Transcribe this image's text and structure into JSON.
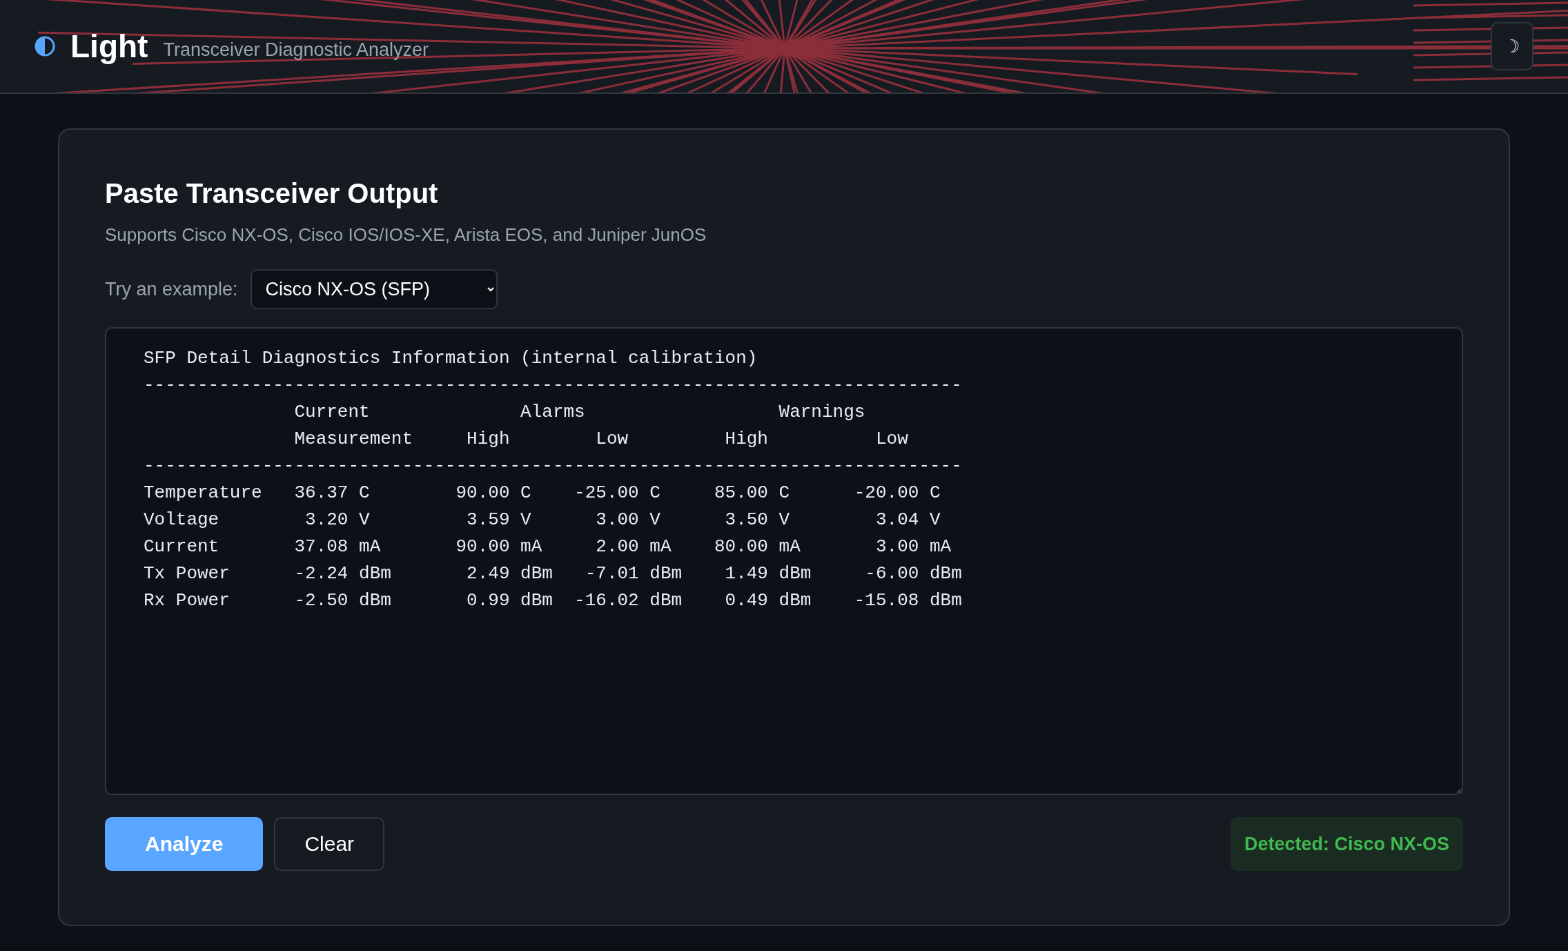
{
  "header": {
    "title": "Light",
    "subtitle": "Transceiver Diagnostic Analyzer",
    "theme_toggle": "☽"
  },
  "panel": {
    "title": "Paste Transceiver Output",
    "description": "Supports Cisco NX-OS, Cisco IOS/IOS-XE, Arista EOS, and Juniper JunOS",
    "example_label": "Try an example:",
    "example_select": {
      "value": "Cisco NX-OS (SFP)"
    },
    "output_text": "SFP Detail Diagnostics Information (internal calibration)\n----------------------------------------------------------------------------\n              Current              Alarms                  Warnings\n              Measurement     High        Low         High          Low\n----------------------------------------------------------------------------\nTemperature   36.37 C        90.00 C    -25.00 C     85.00 C      -20.00 C\nVoltage        3.20 V         3.59 V      3.00 V      3.50 V        3.04 V\nCurrent       37.08 mA       90.00 mA     2.00 mA    80.00 mA       3.00 mA\nTx Power      -2.24 dBm       2.49 dBm   -7.01 dBm    1.49 dBm     -6.00 dBm\nRx Power      -2.50 dBm       0.99 dBm  -16.02 dBm    0.49 dBm    -15.08 dBm",
    "buttons": [
      {
        "label": "Analyze",
        "kind": "primary"
      },
      {
        "label": "Clear",
        "kind": "secondary"
      }
    ],
    "detected": "Detected: Cisco NX-OS"
  }
}
